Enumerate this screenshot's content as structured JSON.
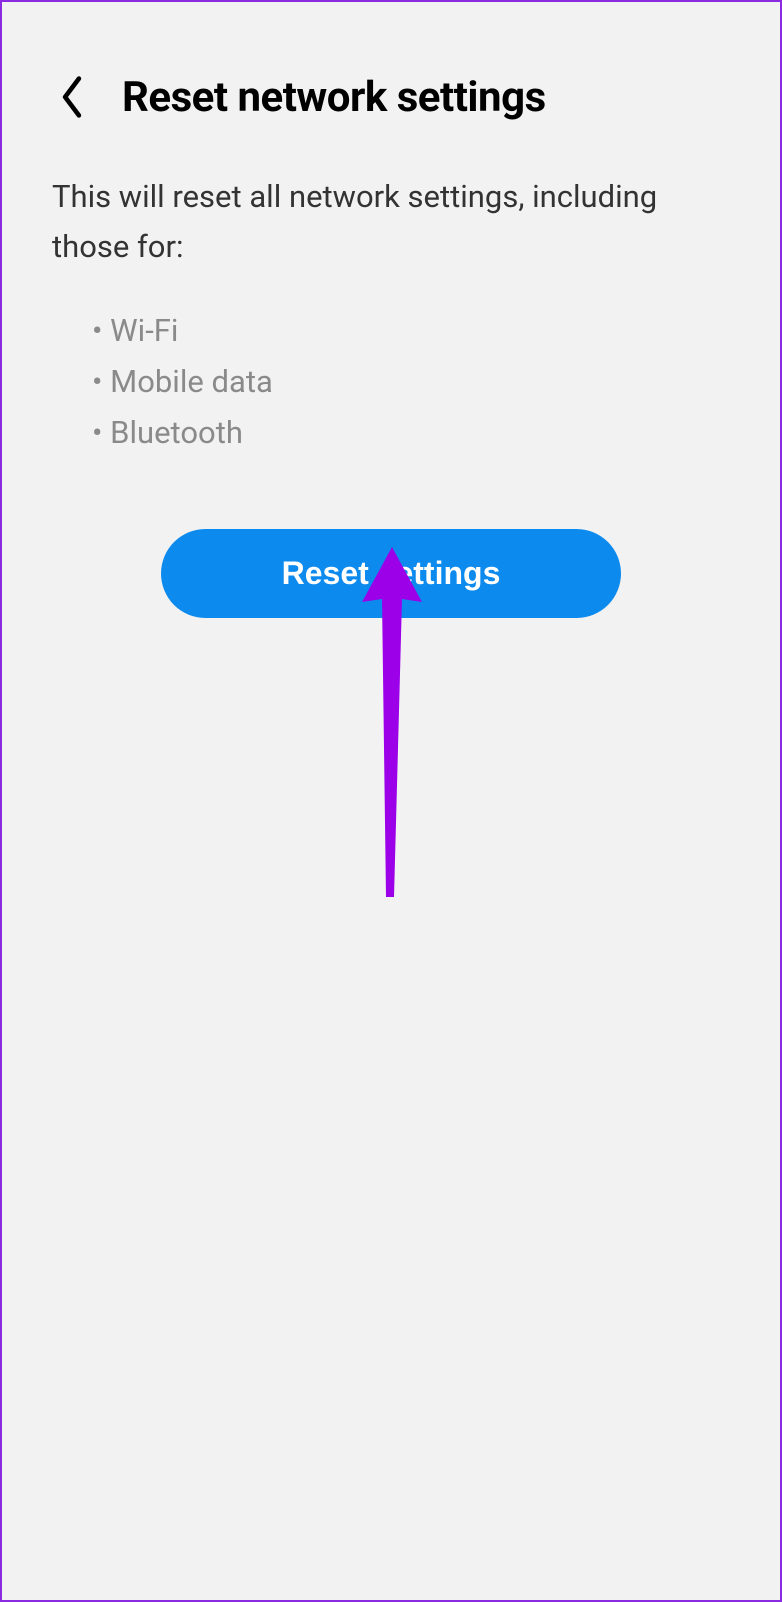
{
  "header": {
    "title": "Reset network settings"
  },
  "description": "This will reset all network settings, including those for:",
  "items": [
    "Wi-Fi",
    "Mobile data",
    "Bluetooth"
  ],
  "button": {
    "label": "Reset settings"
  }
}
